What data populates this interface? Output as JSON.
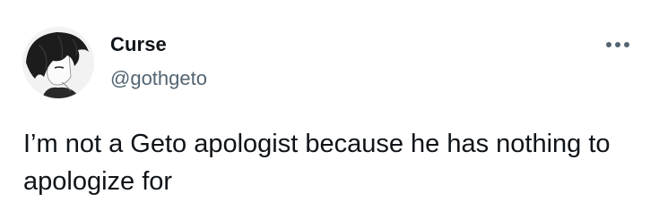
{
  "author": {
    "display_name": "Curse",
    "handle": "@gothgeto",
    "avatar_icon": "anime-avatar"
  },
  "actions": {
    "more_icon": "ellipsis-icon"
  },
  "tweet": {
    "text": "I’m not a Geto apologist because he has nothing to apologize for"
  },
  "colors": {
    "text_primary": "#0f1419",
    "text_secondary": "#536471",
    "background": "#ffffff"
  }
}
